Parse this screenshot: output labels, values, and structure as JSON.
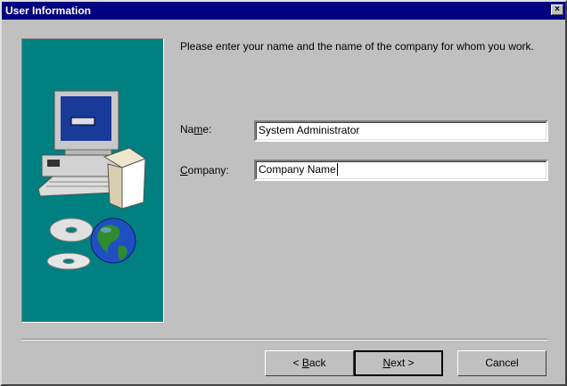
{
  "window": {
    "title": "User Information",
    "close_glyph": "×"
  },
  "intro_text": "Please enter your name and the name of the company for whom you work.",
  "fields": {
    "name": {
      "label_pre": "Na",
      "label_accel": "m",
      "label_post": "e:",
      "value": "System Administrator"
    },
    "company": {
      "label_pre": "",
      "label_accel": "C",
      "label_post": "ompany:",
      "value": "Company Name"
    }
  },
  "buttons": {
    "back": {
      "arrow": "<",
      "accel": "B",
      "rest": "ack"
    },
    "next": {
      "accel": "N",
      "rest": "ext",
      "arrow": ">"
    },
    "cancel": {
      "label": "Cancel"
    }
  },
  "artwork": {
    "icons": [
      "computer-icon",
      "software-box-icon",
      "cd-disc-icon",
      "globe-icon"
    ],
    "panel_color": "#008080"
  }
}
